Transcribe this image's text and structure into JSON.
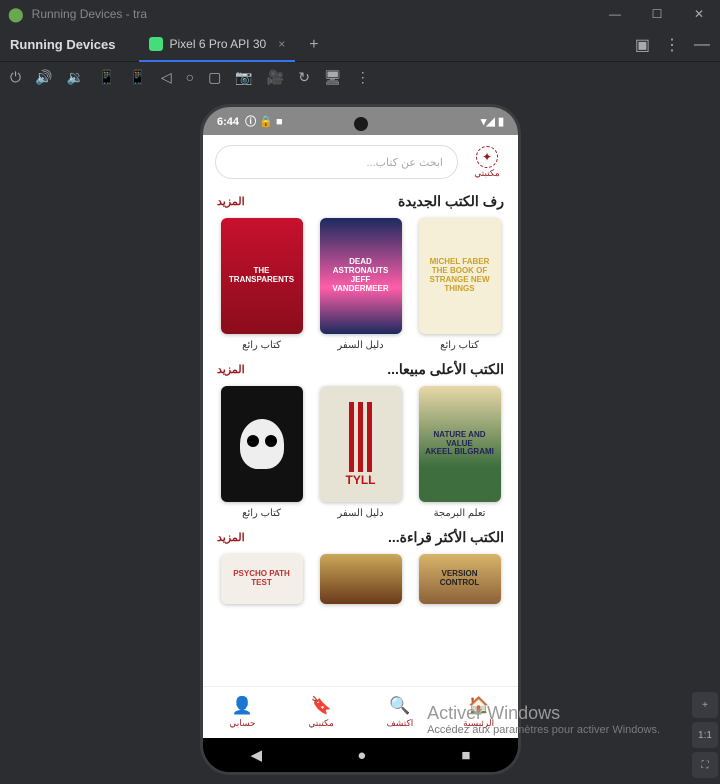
{
  "ide": {
    "title": "Running Devices - tra",
    "running_label": "Running Devices",
    "tab_label": "Pixel 6 Pro API 30",
    "plus": "+",
    "zoom_1": "+",
    "zoom_2": "1:1"
  },
  "device": {
    "status_time": "6:44",
    "nav_back": "◀",
    "nav_home": "●",
    "nav_recent": "■"
  },
  "app": {
    "logo_label": "مكتبتي",
    "search_placeholder": "ابحث عن كتاب...",
    "more_label": "المزيد",
    "sections": [
      {
        "title": "رف الكتب الجديدة",
        "books": [
          {
            "cov": "c3",
            "txt": "MICHEL FABER\\nTHE BOOK OF STRANGE NEW THINGS",
            "cap": "كتاب رائع"
          },
          {
            "cov": "c2",
            "txt": "DEAD ASTRONAUTS\\nJEFF VANDERMEER",
            "cap": "دليل السفر"
          },
          {
            "cov": "c1",
            "txt": "THE TRANSPARENTS",
            "cap": "كتاب رائع"
          }
        ]
      },
      {
        "title": "الكتب الأعلى مبيعا...",
        "books": [
          {
            "cov": "c6",
            "txt": "NATURE AND VALUE\\nAKEEL BILGRAMI",
            "cap": "تعلم البرمجة"
          },
          {
            "cov": "c5",
            "txt": "TYLL",
            "cap": "دليل السفر"
          },
          {
            "cov": "c4",
            "txt": "",
            "cap": "كتاب رائع"
          }
        ]
      },
      {
        "title": "الكتب الأكثر قراءة...",
        "books": [
          {
            "cov": "c9",
            "txt": "VERSION CONTROL",
            "cap": ""
          },
          {
            "cov": "c8",
            "txt": "",
            "cap": ""
          },
          {
            "cov": "c7",
            "txt": "PSYCHO PATH TEST",
            "cap": ""
          }
        ]
      }
    ],
    "bottom": [
      {
        "ic": "🏠",
        "lab": "الرئيسية"
      },
      {
        "ic": "🔍",
        "lab": "اكتشف"
      },
      {
        "ic": "🔖",
        "lab": "مكتبتي"
      },
      {
        "ic": "👤",
        "lab": "حسابي"
      }
    ]
  },
  "watermark": {
    "h": "Activer Windows",
    "s": "Accédez aux paramètres pour activer Windows."
  }
}
